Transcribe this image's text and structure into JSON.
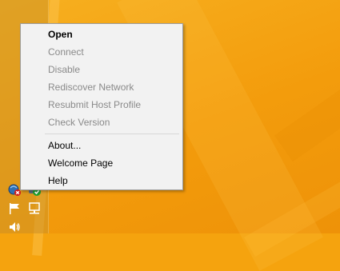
{
  "context_menu": {
    "items": [
      {
        "label": "Open",
        "enabled": true,
        "default": true
      },
      {
        "label": "Connect",
        "enabled": false
      },
      {
        "label": "Disable",
        "enabled": false
      },
      {
        "label": "Rediscover Network",
        "enabled": false
      },
      {
        "label": "Resubmit Host Profile",
        "enabled": false
      },
      {
        "label": "Check Version",
        "enabled": false
      }
    ],
    "items_after_separator": [
      {
        "label": "About...",
        "enabled": true
      },
      {
        "label": "Welcome Page",
        "enabled": true
      },
      {
        "label": "Help",
        "enabled": true
      }
    ]
  },
  "tray": {
    "icons": [
      "network-agent-error-icon",
      "shield-check-icon",
      "flag-icon",
      "network-monitor-icon",
      "speaker-icon"
    ]
  },
  "colors": {
    "desktop": "#f5a30e",
    "menu_background": "#f2f2f2",
    "disabled_text": "#8a8a8a"
  }
}
